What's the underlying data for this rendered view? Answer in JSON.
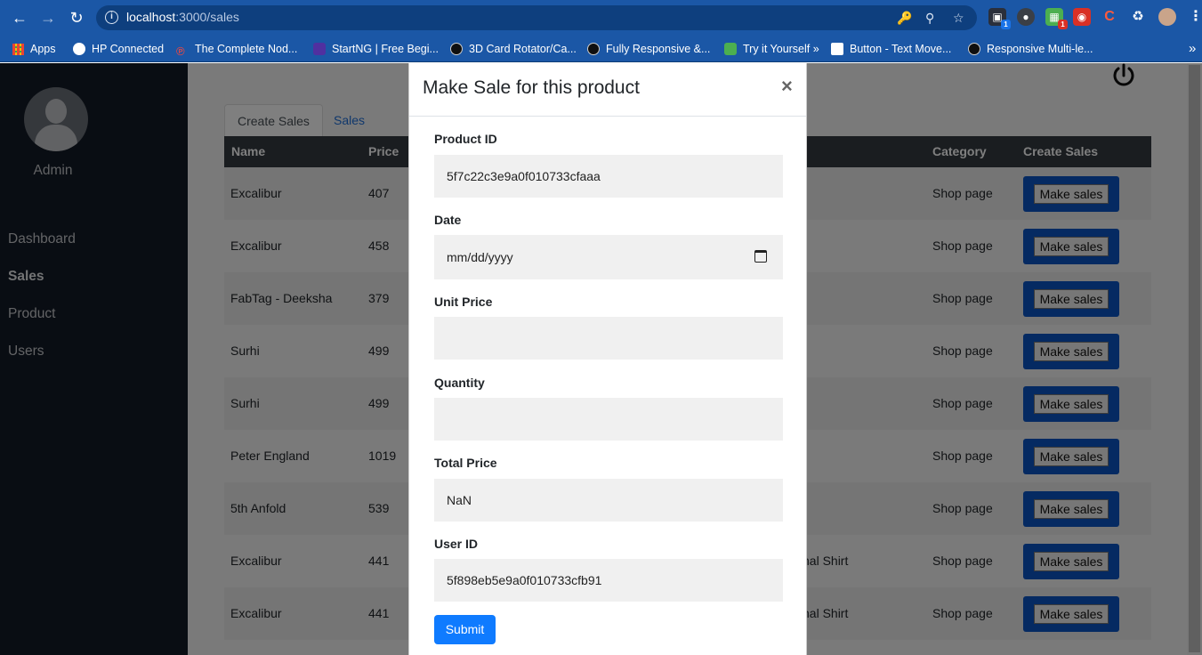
{
  "browser": {
    "url_host": "localhost",
    "url_rest": ":3000/sales",
    "bookmarks": [
      {
        "label": "Apps",
        "color": "#e94235"
      },
      {
        "label": "HP Connected",
        "color": "#ffffff"
      },
      {
        "label": "The Complete Nod...",
        "color": "#e04848"
      },
      {
        "label": "StartNG | Free Begi...",
        "color": "#5030a0"
      },
      {
        "label": "3D Card Rotator/Ca...",
        "color": "#0f0f0f"
      },
      {
        "label": "Fully Responsive &...",
        "color": "#0f0f0f"
      },
      {
        "label": "Try it Yourself »",
        "color": "#4caf50"
      },
      {
        "label": "Button - Text Move...",
        "color": "#ffffff"
      },
      {
        "label": "Responsive Multi-le...",
        "color": "#0f0f0f"
      }
    ],
    "more_bookmarks": "»"
  },
  "sidebar": {
    "user": "Admin",
    "items": [
      "Dashboard",
      "Sales",
      "Product",
      "Users"
    ],
    "active": "Sales"
  },
  "tabs": [
    "Create Sales",
    "Sales"
  ],
  "table": {
    "headers": {
      "name": "Name",
      "price": "Price",
      "category": "Category",
      "create": "Create Sales"
    },
    "action_label": "Make sales",
    "rows": [
      {
        "name": "Excalibur",
        "price": "407",
        "extra": "",
        "category": "Shop page"
      },
      {
        "name": "Excalibur",
        "price": "458",
        "extra": "",
        "category": "Shop page"
      },
      {
        "name": "FabTag - Deeksha",
        "price": "379",
        "extra": "",
        "category": "Shop page"
      },
      {
        "name": "Surhi",
        "price": "499",
        "extra": "",
        "category": "Shop page"
      },
      {
        "name": "Surhi",
        "price": "499",
        "extra": "",
        "category": "Shop page"
      },
      {
        "name": "Peter England",
        "price": "1019",
        "extra": "",
        "category": "Shop page"
      },
      {
        "name": "5th Anfold",
        "price": "539",
        "extra": "",
        "category": "Shop page"
      },
      {
        "name": "Excalibur",
        "price": "441",
        "extra": "nal Shirt",
        "category": "Shop page"
      },
      {
        "name": "Excalibur",
        "price": "441",
        "extra": "nal Shirt",
        "category": "Shop page"
      }
    ]
  },
  "modal": {
    "title": "Make Sale for this product",
    "close": "×",
    "fields": {
      "product_id": {
        "label": "Product ID",
        "value": "5f7c22c3e9a0f010733cfaaa"
      },
      "date": {
        "label": "Date",
        "value": "mm/dd/yyyy"
      },
      "unit_price": {
        "label": "Unit Price",
        "value": ""
      },
      "quantity": {
        "label": "Quantity",
        "value": ""
      },
      "total_price": {
        "label": "Total Price",
        "value": "NaN"
      },
      "user_id": {
        "label": "User ID",
        "value": "5f898eb5e9a0f010733cfb91"
      }
    },
    "submit": "Submit"
  }
}
